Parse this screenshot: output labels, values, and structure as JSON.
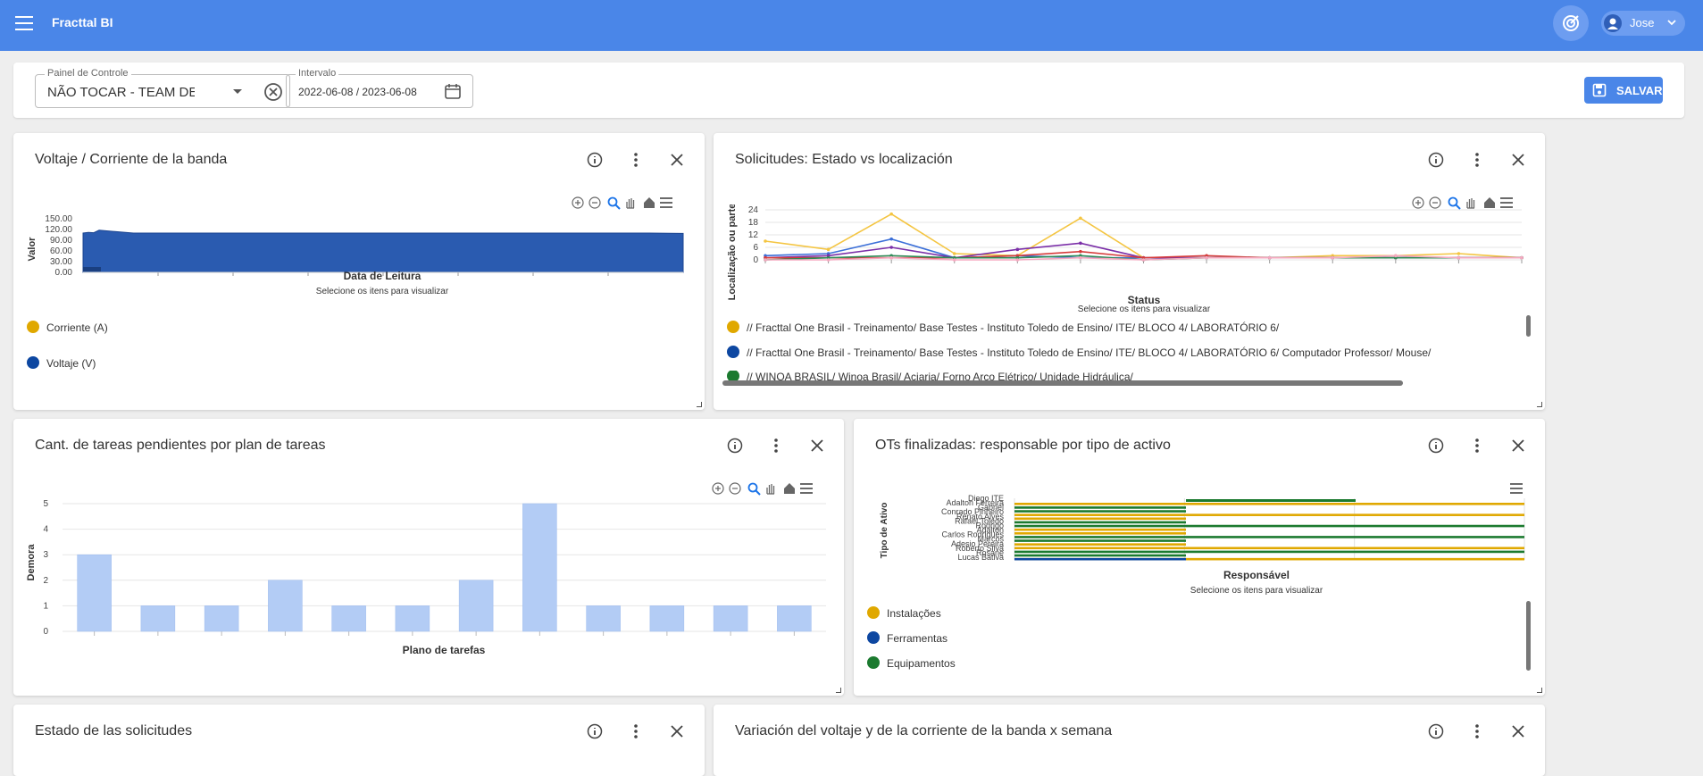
{
  "app": {
    "title": "Fracttal BI",
    "user_name": "Jose"
  },
  "filters": {
    "panel_label": "Painel de Controle",
    "panel_value": "NÃO TOCAR - TEAM DE",
    "interval_label": "Intervalo",
    "interval_value": "2022-06-08 / 2023-06-08",
    "save_label": "SALVAR"
  },
  "colors": {
    "primary": "#4a86e8",
    "yellow": "#e0a800",
    "blue": "#0d47a1",
    "green": "#1b7a2f",
    "bar": "#b3ccf5"
  },
  "cards": {
    "voltage": {
      "title": "Voltaje / Corriente de la banda",
      "hint": "Selecione os itens para visualizar",
      "legend": [
        "Corriente (A)",
        "Voltaje (V)"
      ],
      "chart_data": {
        "type": "area",
        "xlabel": "Data de Leitura",
        "ylabel": "Valor",
        "yticks": [
          "150.00",
          "120.00",
          "90.00",
          "60.00",
          "30.00",
          "0.00"
        ],
        "ylim": [
          0,
          150
        ],
        "series": [
          {
            "name": "Voltaje (V)",
            "values": [
              110,
              112,
              111,
              118,
              110,
              110,
              110,
              110,
              110,
              110,
              110,
              110,
              110,
              110,
              110,
              110,
              110,
              110,
              110,
              110,
              109
            ]
          }
        ]
      }
    },
    "requests": {
      "title": "Solicitudes: Estado vs localización",
      "hint": "Selecione os itens para visualizar",
      "legend": [
        "// Fracttal One Brasil - Treinamento/ Base Testes - Instituto Toledo de Ensino/ ITE/ BLOCO 4/ LABORATÓRIO 6/",
        "// Fracttal One Brasil - Treinamento/ Base Testes - Instituto Toledo de Ensino/ ITE/ BLOCO 4/ LABORATÓRIO 6/ Computador Professor/ Mouse/",
        "// WINOA BRASIL/ Winoa Brasil/ Aciaria/ Forno Arco Elétrico/ Unidade Hidráulica/"
      ],
      "chart_data": {
        "type": "line",
        "xlabel": "Status",
        "ylabel": "Localização ou parte",
        "yticks": [
          "24",
          "18",
          "12",
          "6",
          "0"
        ],
        "ylim": [
          0,
          24
        ],
        "series": [
          {
            "color": "#f4c542",
            "values": [
              9,
              5,
              22,
              3,
              2,
              20,
              1,
              1,
              1,
              2,
              2,
              3,
              1
            ]
          },
          {
            "color": "#3b6fd8",
            "values": [
              2,
              3,
              10,
              1,
              2,
              1,
              1,
              1,
              1,
              1,
              1,
              1,
              1
            ]
          },
          {
            "color": "#7b2fa8",
            "values": [
              1,
              2,
              6,
              1,
              5,
              8,
              1,
              1,
              1,
              1,
              1,
              1,
              1
            ]
          },
          {
            "color": "#d63b3b",
            "values": [
              1,
              1,
              1,
              1,
              2,
              4,
              1,
              2,
              1,
              1,
              1,
              1,
              1
            ]
          },
          {
            "color": "#2e8b57",
            "values": [
              0,
              1,
              2,
              1,
              1,
              2,
              0,
              1,
              1,
              1,
              1,
              1,
              1
            ]
          },
          {
            "color": "#f5a9c0",
            "values": [
              0,
              0,
              1,
              0,
              0,
              1,
              0,
              1,
              1,
              1,
              2,
              1,
              1
            ]
          }
        ]
      }
    },
    "tasks": {
      "title": "Cant. de tareas pendientes por plan de tareas",
      "chart_data": {
        "type": "bar",
        "xlabel": "Plano de tarefas",
        "ylabel": "Demora",
        "yticks": [
          "5",
          "4",
          "3",
          "2",
          "1",
          "0"
        ],
        "ylim": [
          0,
          5
        ],
        "values": [
          3,
          1,
          1,
          2,
          1,
          1,
          2,
          5,
          1,
          1,
          1,
          1
        ]
      }
    },
    "ots": {
      "title": "OTs finalizadas: responsable por tipo de activo",
      "hint": "Selecione os itens para visualizar",
      "legend": [
        "Instalações",
        "Ferramentas",
        "Equipamentos"
      ],
      "ylabels": [
        "Diego ITE",
        "Adalton Ferreira",
        "Gabriel",
        "Conrado Pinheiro",
        "Renato Alves",
        "Rafael Toledo",
        "Rodrigo",
        "Adalton",
        "Carlos Rodrigues",
        "Marcos",
        "Adesio Pereira",
        "Roberto Silva",
        "Rosane",
        "Lucas Bativa"
      ],
      "chart_data": {
        "type": "bar",
        "xlabel": "Responsável",
        "ylabel": "Tipo de Ativo",
        "series": [
          {
            "name": "Instalações"
          },
          {
            "name": "Ferramentas"
          },
          {
            "name": "Equipamentos"
          }
        ]
      }
    },
    "state": {
      "title": "Estado de las solicitudes"
    },
    "variation": {
      "title": "Variación del voltaje y de la corriente de la banda x semana"
    }
  }
}
